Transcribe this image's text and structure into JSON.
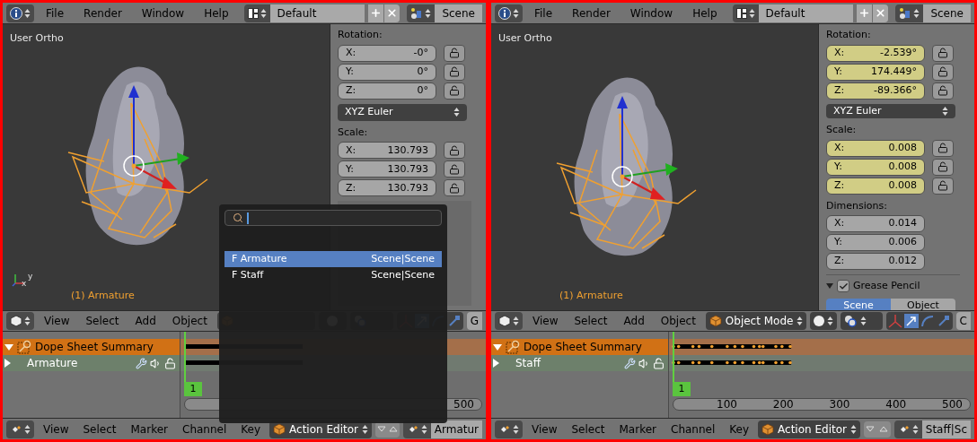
{
  "panels": [
    {
      "top_bar": {
        "menus": [
          "File",
          "Render",
          "Window",
          "Help"
        ],
        "layout": "Default",
        "scene": "Scene"
      },
      "viewport": {
        "view_label": "User Ortho",
        "object_label": "(1) Armature",
        "axis_labels": [
          "x",
          "y"
        ]
      },
      "properties": {
        "rotation": {
          "label": "Rotation:",
          "rows": [
            {
              "axis": "X:",
              "value": "-0°",
              "keyed": false
            },
            {
              "axis": "Y:",
              "value": "0°",
              "keyed": false
            },
            {
              "axis": "Z:",
              "value": "0°",
              "keyed": false
            }
          ]
        },
        "rotation_mode": "XYZ Euler",
        "scale": {
          "label": "Scale:",
          "rows": [
            {
              "axis": "X:",
              "value": "130.793",
              "keyed": false
            },
            {
              "axis": "Y:",
              "value": "130.793",
              "keyed": false
            },
            {
              "axis": "Z:",
              "value": "130.793",
              "keyed": false
            }
          ]
        },
        "dimensions_hidden": true
      },
      "view3d_header": {
        "menus": [
          "View",
          "Select",
          "Add",
          "Object"
        ],
        "cut_label": "G"
      },
      "dope_sheet": {
        "channels": [
          {
            "kind": "summary",
            "name": "Dope Sheet Summary",
            "expanded": true
          },
          {
            "kind": "object",
            "name": "Armature",
            "expanded": false
          }
        ],
        "current_frame": "1",
        "ticks": [
          "500"
        ],
        "keyframes_visible": false
      },
      "dopesheet_header": {
        "menus": [
          "View",
          "Select",
          "Marker",
          "Channel",
          "Key"
        ],
        "mode": "Action Editor",
        "action": "Armatur"
      },
      "search_popup": {
        "items": [
          {
            "name": "F Armature",
            "scene": "Scene|Scene",
            "selected": true
          },
          {
            "name": "F Staff",
            "scene": "Scene|Scene",
            "selected": false
          }
        ]
      }
    },
    {
      "top_bar": {
        "menus": [
          "File",
          "Render",
          "Window",
          "Help"
        ],
        "layout": "Default",
        "scene": "Scene"
      },
      "viewport": {
        "view_label": "User Ortho",
        "object_label": "(1) Armature"
      },
      "properties": {
        "rotation": {
          "label": "Rotation:",
          "rows": [
            {
              "axis": "X:",
              "value": "-2.539°",
              "keyed": true
            },
            {
              "axis": "Y:",
              "value": "174.449°",
              "keyed": true
            },
            {
              "axis": "Z:",
              "value": "-89.366°",
              "keyed": true
            }
          ]
        },
        "rotation_mode": "XYZ Euler",
        "scale": {
          "label": "Scale:",
          "rows": [
            {
              "axis": "X:",
              "value": "0.008",
              "keyed": true
            },
            {
              "axis": "Y:",
              "value": "0.008",
              "keyed": true
            },
            {
              "axis": "Z:",
              "value": "0.008",
              "keyed": true
            }
          ]
        },
        "dimensions": {
          "label": "Dimensions:",
          "rows": [
            {
              "axis": "X:",
              "value": "0.014"
            },
            {
              "axis": "Y:",
              "value": "0.006"
            },
            {
              "axis": "Z:",
              "value": "0.012"
            }
          ]
        },
        "grease_pencil": {
          "label": "Grease Pencil",
          "checked": true
        },
        "tabs": [
          {
            "label": "Scene",
            "selected": true
          },
          {
            "label": "Object",
            "selected": false
          }
        ]
      },
      "view3d_header": {
        "menus": [
          "View",
          "Select",
          "Add",
          "Object"
        ],
        "mode": "Object Mode",
        "cut_label": "C"
      },
      "dope_sheet": {
        "channels": [
          {
            "kind": "summary",
            "name": "Dope Sheet Summary",
            "expanded": true
          },
          {
            "kind": "object",
            "name": "Staff",
            "expanded": false
          }
        ],
        "current_frame": "1",
        "ticks": [
          "100",
          "200",
          "300",
          "400",
          "500"
        ],
        "keyframes_visible": true
      },
      "dopesheet_header": {
        "menus": [
          "View",
          "Select",
          "Marker",
          "Channel",
          "Key"
        ],
        "mode": "Action Editor",
        "action": "Staff|Sc"
      }
    }
  ]
}
